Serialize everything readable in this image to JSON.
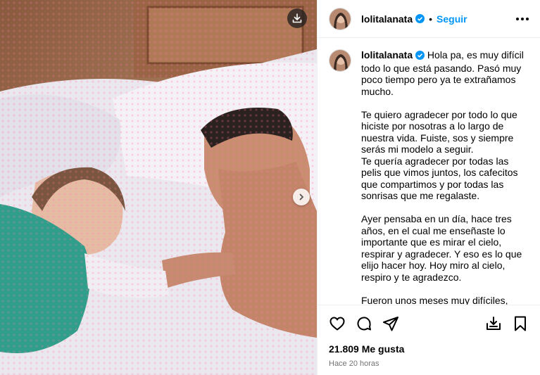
{
  "post": {
    "username": "lolitalanata",
    "follow_label": "Seguir",
    "dot": "•",
    "caption": "Hola pa, es muy difícil todo lo que está pasando. Pasó muy poco tiempo pero ya te extrañamos mucho.\n\nTe quiero agradecer por todo lo que hiciste por nosotras a lo largo de nuestra vida. Fuiste, sos y siempre serás mi modelo a seguir.\nTe quería agradecer por todas las pelis que vimos juntos, los cafecitos que compartimos y por todas las sonrisas que me regalaste.\n\nAyer pensaba en un día, hace tres años, en el cual me enseñaste lo importante que es mirar el cielo, respirar y agradecer. Y eso es lo que elijo hacer hoy. Hoy miro al cielo, respiro y te agradezco.\n\nFueron unos meses muy difíciles, pero",
    "likes": "21.809 Me gusta",
    "time": "Hace 20 horas"
  },
  "icons": {
    "download": "download-icon",
    "next": "chevron-right-icon",
    "verified": "verified-badge-icon",
    "like": "heart-icon",
    "comment": "comment-icon",
    "share": "share-icon",
    "save": "bookmark-icon",
    "add": "add-to-collection-icon",
    "more": "more-options-icon"
  },
  "colors": {
    "accent": "#0095f6",
    "verified": "#0095f6",
    "muted": "#737373"
  }
}
